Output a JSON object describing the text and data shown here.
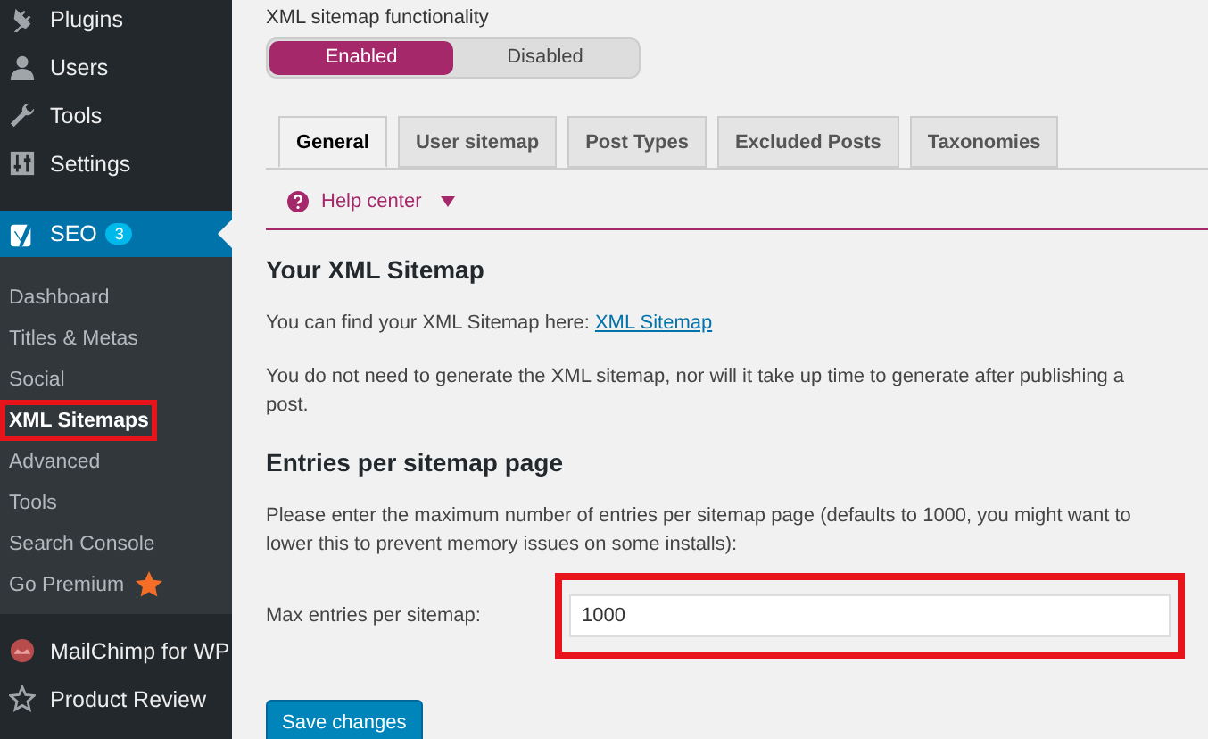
{
  "sidebar": {
    "top_items": [
      {
        "label": "Plugins",
        "kind": "plugin",
        "selected": false
      },
      {
        "label": "Users",
        "kind": "user",
        "selected": false
      },
      {
        "label": "Tools",
        "kind": "wrench",
        "selected": false
      },
      {
        "label": "Settings",
        "kind": "sliders",
        "selected": false
      }
    ],
    "current": {
      "label": "SEO",
      "badge": "3",
      "selected": true
    },
    "submenu": [
      {
        "label": "Dashboard",
        "selected": false,
        "annotated": false,
        "star": false
      },
      {
        "label": "Titles & Metas",
        "selected": false,
        "annotated": false,
        "star": false
      },
      {
        "label": "Social",
        "selected": false,
        "annotated": false,
        "star": false
      },
      {
        "label": "XML Sitemaps",
        "selected": true,
        "annotated": true,
        "star": false
      },
      {
        "label": "Advanced",
        "selected": false,
        "annotated": false,
        "star": false
      },
      {
        "label": "Tools",
        "selected": false,
        "annotated": false,
        "star": false
      },
      {
        "label": "Search Console",
        "selected": false,
        "annotated": false,
        "star": false
      },
      {
        "label": "Go Premium",
        "selected": false,
        "annotated": false,
        "star": true
      }
    ],
    "bottom_items": [
      {
        "label": "MailChimp for WP",
        "kind": "chimp",
        "selected": false
      },
      {
        "label": "Product Review",
        "kind": "star",
        "selected": false
      }
    ]
  },
  "functionality": {
    "label": "XML sitemap functionality",
    "options": [
      {
        "label": "Enabled",
        "selected": true
      },
      {
        "label": "Disabled",
        "selected": false
      }
    ]
  },
  "tabs": [
    {
      "label": "General",
      "selected": true
    },
    {
      "label": "User sitemap",
      "selected": false
    },
    {
      "label": "Post Types",
      "selected": false
    },
    {
      "label": "Excluded Posts",
      "selected": false
    },
    {
      "label": "Taxonomies",
      "selected": false
    }
  ],
  "help": {
    "label": "Help center",
    "expanded": false
  },
  "sections": [
    {
      "heading": "Your XML Sitemap",
      "paragraphs": [
        {
          "text": "You can find your XML Sitemap here: ",
          "link": "XML Sitemap"
        },
        {
          "text": "You do not need to generate the XML sitemap, nor will it take up time to generate after publishing a post."
        }
      ]
    },
    {
      "heading": "Entries per sitemap page",
      "paragraphs": [
        {
          "text": "Please enter the maximum number of entries per sitemap page (defaults to 1000, you might want to lower this to prevent memory issues on some installs):"
        }
      ]
    }
  ],
  "field": {
    "label": "Max entries per sitemap:",
    "value": "1000",
    "annotated": true
  },
  "save_button": "Save changes"
}
